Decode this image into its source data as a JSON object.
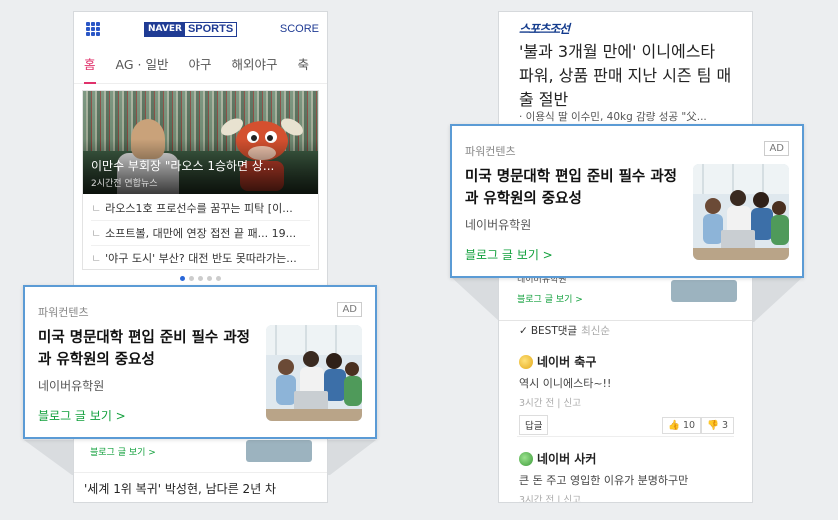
{
  "left": {
    "header": {
      "logo_naver": "NAVER",
      "logo_sports": "SPORTS",
      "score": "SCORE",
      "menu_icon": "grid-icon"
    },
    "tabs": [
      "홈",
      "AG · 일반",
      "야구",
      "해외야구",
      "축"
    ],
    "active_tab": 0,
    "headline_card": {
      "title": "이만수 부회장 \"라오스 1승하면 상...",
      "meta": "2시간전 연합뉴스"
    },
    "news_items": [
      "라오스1호 프로선수를 꿈꾸는 피탁 [이...",
      "소프트볼, 대만에 연장 접전 끝 패... 19...",
      "'야구 도시' 부산? 대전 반도 못따라가는..."
    ],
    "carousel": {
      "total": 5,
      "current": 1
    },
    "behind_ad_link": "블로그 글 보기 >",
    "bottom_news": "'세계 1위 복귀' 박성현, 남다른 2년 차"
  },
  "right": {
    "source_logo": "스포츠조선",
    "headline": "'불과 3개월 만에' 이니에스타 파워, 상품 판매 지난 시즌 팀 매출 절반",
    "subline": "· 이용식 딸 이수민, 40kg 감량 성공 \"父...",
    "behind_ad_text": "네이버유학원",
    "behind_ad_link": "블로그 글 보기 >",
    "best_label": "BEST댓글",
    "sort_label": "최신순",
    "comments": [
      {
        "name": "네이버 축구",
        "text": "역시 이니에스타~!!",
        "meta": "3시간 전 | 신고",
        "reply": "답글",
        "likes": "10",
        "dislikes": "3",
        "badge": "gold"
      },
      {
        "name": "네이버 사커",
        "text": "큰 돈 주고 영입한 이유가 분명하구만",
        "meta": "3시간 전 | 신고",
        "badge": "green"
      }
    ]
  },
  "ad": {
    "label": "파워컨텐츠",
    "badge": "AD",
    "title": "미국 명문대학 편입 준비 필수 과정과 유학원의 중요성",
    "advertiser": "네이버유학원",
    "cta": "블로그 글 보기 >"
  },
  "colors": {
    "accent_tab": "#e0316b",
    "cta_green": "#12a03c",
    "ad_border": "#5b9bd5",
    "naver_blue": "#1f3b94"
  }
}
